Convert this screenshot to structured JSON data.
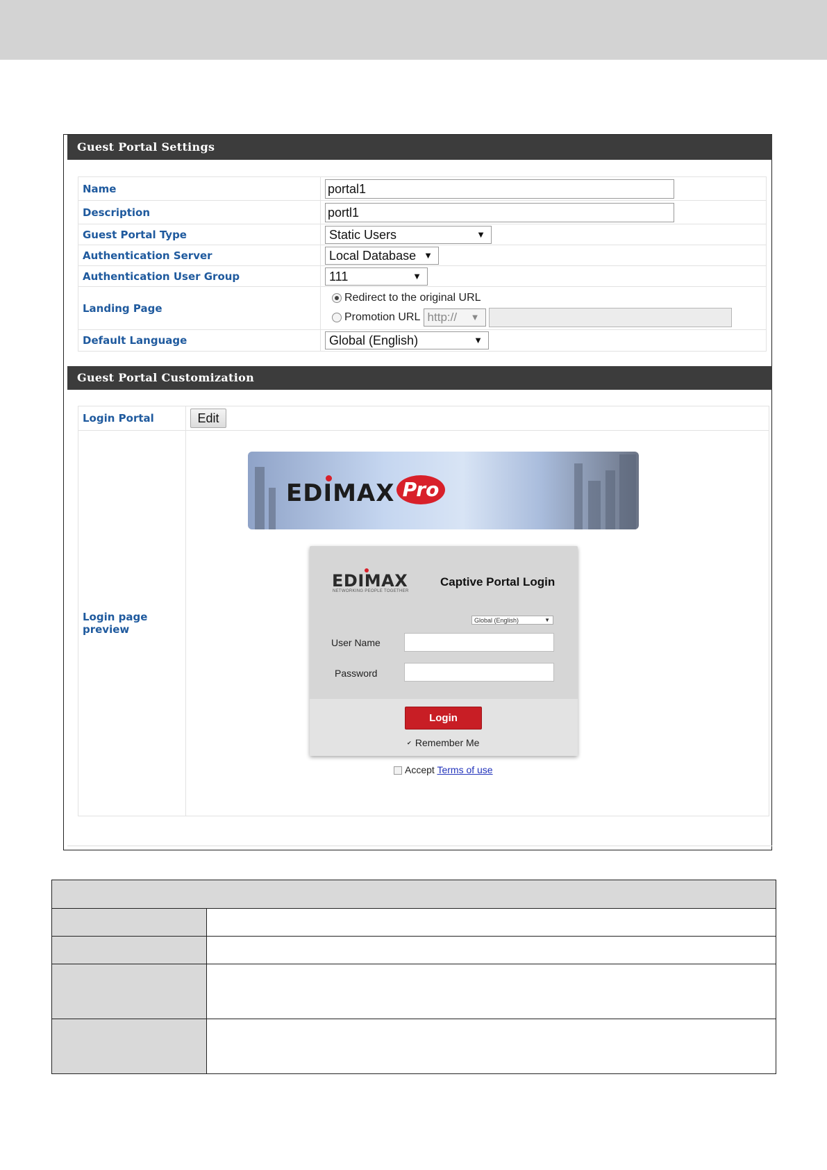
{
  "settings": {
    "title": "Guest Portal Settings",
    "name_label": "Name",
    "name_value": "portal1",
    "description_label": "Description",
    "description_value": "portl1",
    "portal_type_label": "Guest Portal Type",
    "portal_type_value": "Static Users",
    "auth_server_label": "Authentication Server",
    "auth_server_value": "Local Database",
    "auth_group_label": "Authentication User Group",
    "auth_group_value": "111",
    "landing_label": "Landing Page",
    "landing_option_redirect": "Redirect to the original URL",
    "landing_option_promotion": "Promotion URL",
    "promotion_protocol": "http://",
    "promotion_url_value": "",
    "language_label": "Default Language",
    "language_value": "Global (English)"
  },
  "customization": {
    "title": "Guest Portal Customization",
    "login_portal_label": "Login Portal",
    "edit_button": "Edit",
    "preview_label": "Login page preview"
  },
  "preview": {
    "banner_logo": "EDIMAX",
    "banner_pro": "Pro",
    "card_logo": "EDIMAX",
    "card_logo_tagline": "NETWORKING PEOPLE TOGETHER",
    "card_title": "Captive Portal Login",
    "language_select": "Global (English)",
    "username_label": "User Name",
    "password_label": "Password",
    "login_button": "Login",
    "remember_me": "Remember Me",
    "accept_text": "Accept",
    "terms_link": "Terms of use"
  },
  "colors": {
    "header_bg": "#3c3c3c",
    "label_blue": "#1f5a9e",
    "login_red": "#c81e25"
  }
}
